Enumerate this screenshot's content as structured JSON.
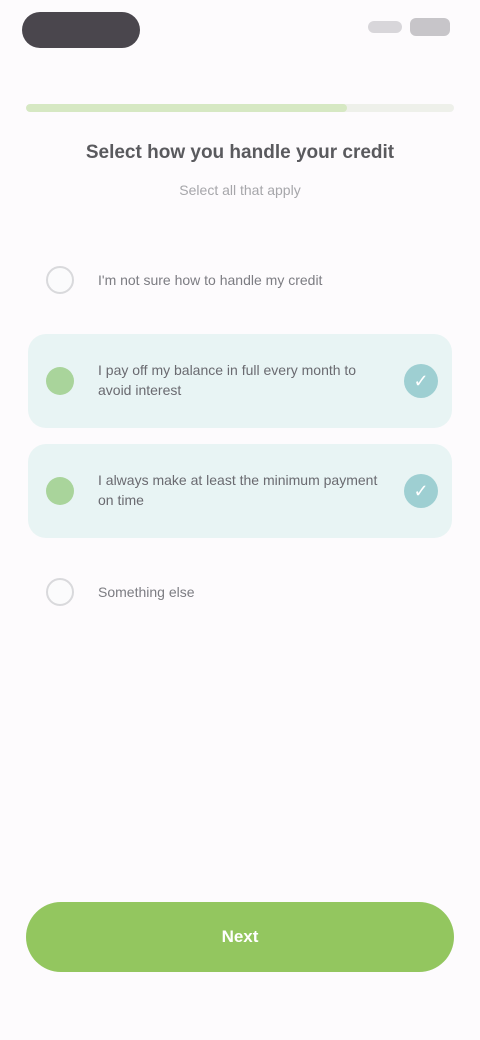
{
  "progress": 0.75,
  "question": {
    "title": "Select how you handle your credit",
    "subtitle": "Select all that apply"
  },
  "options": [
    {
      "label": "I'm not sure how to handle my credit",
      "selected": false
    },
    {
      "label": "I pay off my balance in full every month to avoid interest",
      "selected": true
    },
    {
      "label": "I always make at least the minimum payment on time",
      "selected": true
    },
    {
      "label": "Something else",
      "selected": false
    }
  ],
  "buttons": {
    "next_label": "Next"
  },
  "colors": {
    "accent": "#93c65f",
    "selected_bg": "#e8f4f4",
    "check": "#9ecfd2"
  }
}
